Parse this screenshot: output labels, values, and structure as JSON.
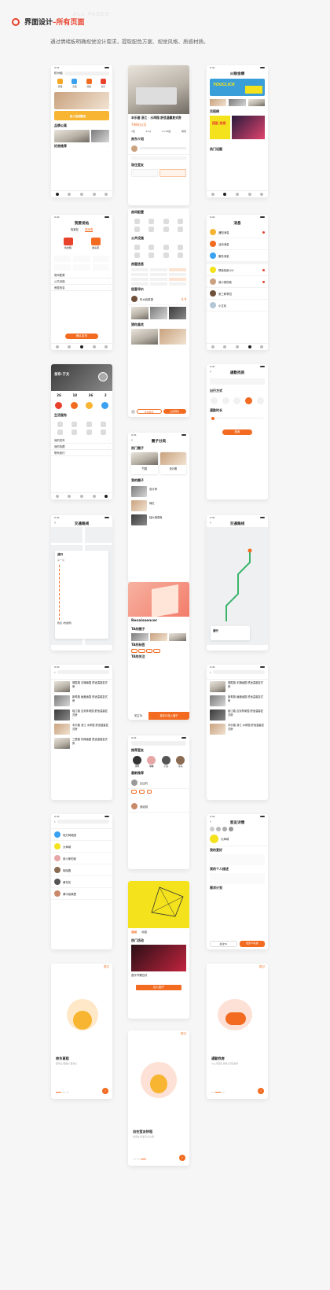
{
  "header": {
    "title_main": "界面设计",
    "title_accent": "–所有页面",
    "ghost_text": "ALL PAGES",
    "subtitle": "通过情绪板明确视觉设计需求，提取配色方案、视觉风格、质感材质。"
  },
  "colors": {
    "accent": "#e8412c",
    "orange": "#f26b21",
    "yellow": "#f3e21c",
    "bg": "#f6f6f6"
  },
  "screens": {
    "home": {
      "city": "杭州临",
      "banner_text": "私人定制服务",
      "section_brand": "品牌公寓",
      "section_nearby": "好房推荐",
      "icons": [
        "整租",
        "合租",
        "短租",
        "新房"
      ]
    },
    "detail": {
      "title": "丰乐基 浙江 · 水岸园 舒适温馨复式房",
      "price": "7980元/月",
      "tags": [
        "2室",
        "97㎡",
        "17/18层",
        "朝南"
      ],
      "agent_section": "房东介绍",
      "roommate_section": "现住室友"
    },
    "recommend": {
      "title": "火眼金睛",
      "banner1": "YOUCLICK",
      "section_popular": "百搭榜",
      "banner2": "搭配 思想",
      "section_hot": "热门话题"
    },
    "post": {
      "title": "我要发帖",
      "tab1": "找室友",
      "tab2": "发房源",
      "opt1": "找合租",
      "opt2": "发房源",
      "rows": [
        "房间配置",
        "公共设施",
        "房屋信息"
      ],
      "submit": "确认发布"
    },
    "config": {
      "section_room": "房间配置",
      "section_public": "公共设施",
      "section_info": "房屋信息",
      "section_review": "租客评价",
      "reviewer": "年大叔英语",
      "score": "4.9",
      "section_nearby": "猜你喜欢",
      "contact": "在线联系",
      "book": "立即预约"
    },
    "messages": {
      "title": "消息",
      "items": [
        "通知消息",
        "活动消息",
        "服务消息"
      ],
      "chats": [
        "帮我找房小U",
        "我小家的我",
        "张三和李四",
        "小文化"
      ]
    },
    "profile": {
      "name": "发布·于文",
      "stats": [
        "26",
        "18",
        "36",
        "2"
      ],
      "section_life": "生活服务",
      "rows": [
        "我的发布",
        "我的收藏",
        "联系我们"
      ]
    },
    "circles": {
      "title": "圈子分类",
      "section_hot": "热门圈子",
      "c1": "竹园",
      "c2": "设计圈",
      "section_mine": "我的圈子",
      "posts": [
        "设计师",
        "网红",
        "独大相录像"
      ]
    },
    "commute": {
      "title": "通勤找房",
      "section_way": "出行方式",
      "section_time": "通勤时长",
      "btn": "搜索"
    },
    "route1": {
      "title": "交通路线",
      "stop": "通行",
      "note": "第一站",
      "end": "终点 (市政府)"
    },
    "route2": {
      "title": "交通路线",
      "stop": "通行"
    },
    "renaissance": {
      "name": "Renaissencer",
      "section_circles": "TA的圈子",
      "section_tags": "TA的标签",
      "section_follow": "TA的关注",
      "follow": "关注TA",
      "chat": "邀请TA加入圈子"
    },
    "listing1": {
      "items": [
        "德胜路 无锡幽园 舒适温馨复式房",
        "新希路 幽盖幽园 舒适温馨复式房",
        "临江路 吉安林家园 舒适温馨复式房",
        "丰乐路 浙江 水岸园 舒适温馨复式房",
        "三里路 珍珠幽园 舒适温馨复式房"
      ]
    },
    "listing2": {
      "items": [
        "德胜路 无锡幽园 舒适温馨复式房",
        "新希路 幽盖幽园 舒适温馨复式房",
        "临江路 吉安林家园 舒适温馨复式房",
        "丰乐路 浙江 水岸园 舒适温馨复式房"
      ]
    },
    "friends": {
      "section_rec": "推荐室友",
      "names": [
        "汤姆",
        "琳琳",
        "小白",
        "东东"
      ],
      "section_news": "最新推荐",
      "post1": "比比约",
      "post2": "张收到"
    },
    "agents": {
      "names": [
        "地万网络团",
        "大海域",
        "张小家的我",
        "晓晓路",
        "黄花花",
        "黄中高满里"
      ]
    },
    "roommate_detail": {
      "title": "室友详情",
      "name": "大海域",
      "sections": [
        "我的爱好",
        "我的个人描述",
        "需求计划"
      ],
      "follow": "关注TA",
      "chat": "发送TA私信"
    },
    "event": {
      "tab1": "活动",
      "tab2": "动态",
      "section": "热门活动",
      "event_title": "音乐节第四次",
      "join": "加入圈子"
    },
    "onboard1": {
      "skip": "跳过",
      "title": "房东直租",
      "desc": "更专业 更放心 更省心"
    },
    "onboard2": {
      "skip": "跳过",
      "title": "通勤找房",
      "desc": "以公司定位 找离公司近的房"
    },
    "onboard3": {
      "skip": "跳过",
      "title": "自在室友拼租",
      "desc": "好室友 好生活 好心情"
    }
  }
}
